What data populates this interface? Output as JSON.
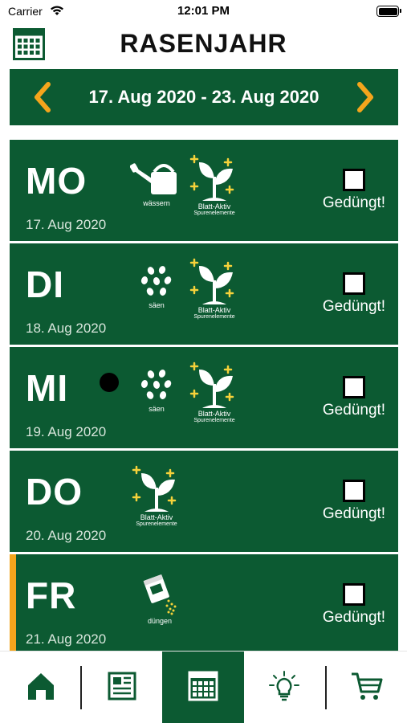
{
  "status_bar": {
    "carrier": "Carrier",
    "time": "12:01 PM"
  },
  "header": {
    "title": "RASENJAHR",
    "calendar_icon": "calendar-grid-icon"
  },
  "week": {
    "range": "17. Aug 2020 - 23. Aug 2020",
    "prev_icon": "chevron-left-icon",
    "next_icon": "chevron-right-icon"
  },
  "days": [
    {
      "name": "MO",
      "date": "17. Aug 2020",
      "check_label": "Gedüngt!",
      "checked": false,
      "activities": [
        {
          "icon": "watering-can-icon",
          "label": "wässern"
        },
        {
          "icon": "leaf-sprout-icon",
          "label": "Blatt-Aktiv",
          "sublabel": "Spurenelemente"
        }
      ]
    },
    {
      "name": "DI",
      "date": "18. Aug 2020",
      "check_label": "Gedüngt!",
      "checked": false,
      "activities": [
        {
          "icon": "seeds-icon",
          "label": "säen"
        },
        {
          "icon": "leaf-sprout-icon",
          "label": "Blatt-Aktiv",
          "sublabel": "Spurenelemente"
        }
      ]
    },
    {
      "name": "MI",
      "date": "19. Aug 2020",
      "check_label": "Gedüngt!",
      "checked": false,
      "activities": [
        {
          "icon": "seeds-icon",
          "label": "säen"
        },
        {
          "icon": "leaf-sprout-icon",
          "label": "Blatt-Aktiv",
          "sublabel": "Spurenelemente"
        }
      ]
    },
    {
      "name": "DO",
      "date": "20. Aug 2020",
      "check_label": "Gedüngt!",
      "checked": false,
      "activities": [
        {
          "icon": "leaf-sprout-icon",
          "label": "Blatt-Aktiv",
          "sublabel": "Spurenelemente"
        }
      ]
    },
    {
      "name": "FR",
      "date": "21. Aug 2020",
      "check_label": "Gedüngt!",
      "checked": false,
      "today": true,
      "activities": [
        {
          "icon": "fertilizer-bag-icon",
          "label": "düngen"
        }
      ]
    }
  ],
  "tabbar": {
    "tabs": [
      {
        "icon": "home-icon",
        "active": false
      },
      {
        "icon": "newspaper-icon",
        "active": false
      },
      {
        "icon": "calendar-grid-icon",
        "active": true
      },
      {
        "icon": "lightbulb-icon",
        "active": false
      },
      {
        "icon": "shopping-cart-icon",
        "active": false
      }
    ]
  },
  "colors": {
    "brand_green": "#0c5a32",
    "accent_orange": "#f4a51c",
    "sparkle_yellow": "#f6d23a"
  }
}
